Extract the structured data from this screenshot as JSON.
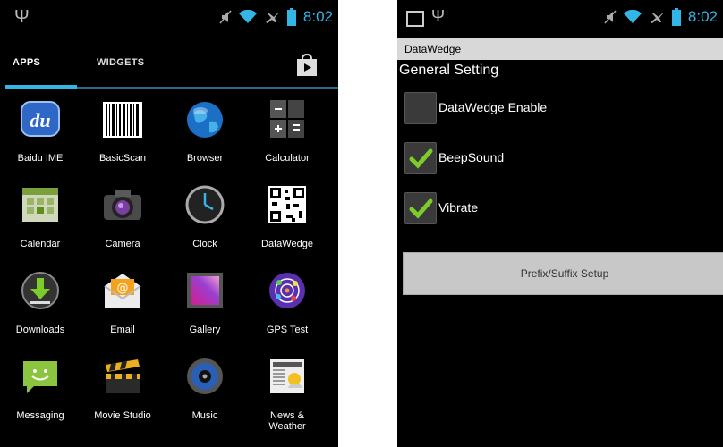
{
  "status_bar": {
    "time": "8:02"
  },
  "launcher": {
    "tabs": {
      "apps": "APPS",
      "widgets": "WIDGETS"
    },
    "apps": [
      {
        "label": "Baidu IME",
        "icon": "baidu-ime-icon"
      },
      {
        "label": "BasicScan",
        "icon": "barcode-icon"
      },
      {
        "label": "Browser",
        "icon": "globe-icon"
      },
      {
        "label": "Calculator",
        "icon": "calculator-icon"
      },
      {
        "label": "Calendar",
        "icon": "calendar-icon"
      },
      {
        "label": "Camera",
        "icon": "camera-icon"
      },
      {
        "label": "Clock",
        "icon": "clock-icon"
      },
      {
        "label": "DataWedge",
        "icon": "qr-code-icon"
      },
      {
        "label": "Downloads",
        "icon": "download-icon"
      },
      {
        "label": "Email",
        "icon": "email-icon"
      },
      {
        "label": "Gallery",
        "icon": "gallery-icon"
      },
      {
        "label": "GPS Test",
        "icon": "gps-icon"
      },
      {
        "label": "Messaging",
        "icon": "messaging-icon"
      },
      {
        "label": "Movie Studio",
        "icon": "clapperboard-icon"
      },
      {
        "label": "Music",
        "icon": "speaker-icon"
      },
      {
        "label": "News &\nWeather",
        "icon": "newspaper-icon"
      }
    ]
  },
  "datawedge": {
    "title": "DataWedge",
    "section": "General Setting",
    "enable_label": "DataWedge Enable",
    "enable_checked": false,
    "beep_label": "BeepSound",
    "beep_checked": true,
    "vibrate_label": "Vibrate",
    "vibrate_checked": true,
    "setup_button": "Prefix/Suffix Setup"
  },
  "colors": {
    "accent": "#33b5e5",
    "check": "#7ccc2a"
  }
}
